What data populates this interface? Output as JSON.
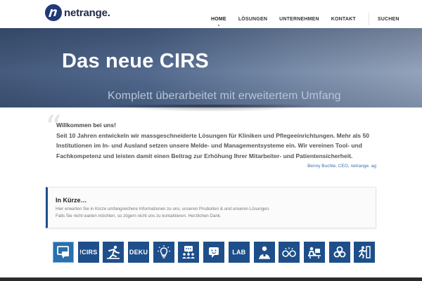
{
  "brand": {
    "name": "netrange.",
    "logo_icon": "netrange-n-logo-icon",
    "color": "#1f3a7a"
  },
  "nav": {
    "items": [
      {
        "label": "HOME",
        "active": true
      },
      {
        "label": "LÖSUNGEN",
        "active": false
      },
      {
        "label": "UNTERNEHMEN",
        "active": false
      },
      {
        "label": "KONTAKT",
        "active": false
      }
    ],
    "search_label": "SUCHEN"
  },
  "hero": {
    "title": "Das neue CIRS",
    "subtitle": "Komplett überarbeitet mit erweitertem Umfang"
  },
  "intro": {
    "welcome": "Willkommen bei uns!",
    "text": "Seit 10 Jahren entwickeln wir massgeschneiderte Lösungen für Kliniken und Pflegeeinrichtungen. Mehr als 50 Institutionen im In- und Ausland setzen unsere Melde- und Managementsysteme ein. Wir vereinen Tool- und Fachkompetenz und leisten damit einen Beitrag zur Erhöhung Ihrer Mitarbeiter- und Patientensicherheit.",
    "author": "Benny Buchle, CEO, netrange. ag"
  },
  "infobox": {
    "title": "In Kürze…",
    "line1": "Hier erwarten Sie in Kürze umfangreichere Informationen zu uns, unseren Produkten & und unseren Lösungen.",
    "line2": "Falls Sie nicht warten möchten, so zögern nicht uns zu kontaktieren. Herzlichen Dank."
  },
  "tiles": [
    {
      "icon": "monitor-chat-icon"
    },
    {
      "label": "!CIRS"
    },
    {
      "icon": "falling-person-icon"
    },
    {
      "label": "DEKU"
    },
    {
      "icon": "lightbulb-icon"
    },
    {
      "icon": "group-chat-icon"
    },
    {
      "icon": "speech-bubble-icon"
    },
    {
      "label": "LAB"
    },
    {
      "icon": "person-badge-icon"
    },
    {
      "icon": "glasses-icon"
    },
    {
      "icon": "desk-worker-icon"
    },
    {
      "icon": "biohazard-icon"
    },
    {
      "icon": "emergency-exit-icon"
    }
  ],
  "colors": {
    "accent": "#1e4f8a",
    "link": "#3f6fb0",
    "hero_start": "#3e5477",
    "hero_end": "#90a0b9"
  }
}
